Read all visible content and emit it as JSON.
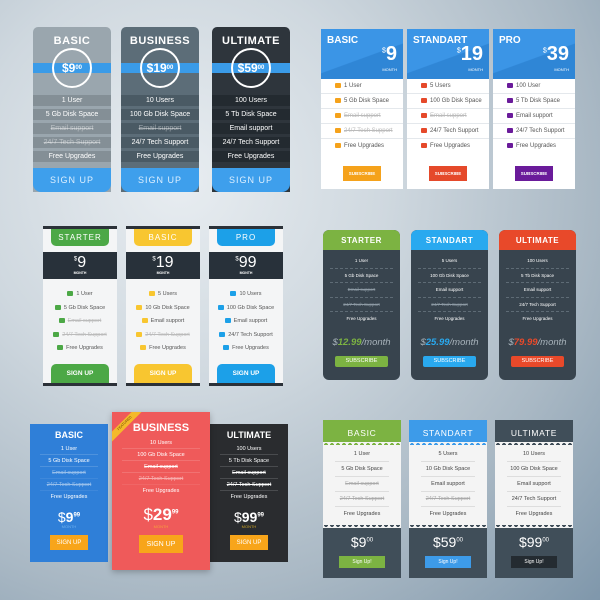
{
  "set1": {
    "colors": {
      "band": "#3a9be8",
      "button": "#3e9fec"
    },
    "plans": [
      {
        "name": "BASIC",
        "price": "$9",
        "cents": "00",
        "bg": "#9aa6ae",
        "row": "#848f96",
        "features": [
          {
            "text": "1 User",
            "active": true
          },
          {
            "text": "5 Gb Disk Space",
            "active": true
          },
          {
            "text": "Email support",
            "active": false
          },
          {
            "text": "24/7 Tech Support",
            "active": false
          },
          {
            "text": "Free Upgrades",
            "active": true
          }
        ],
        "button": "SIGN UP"
      },
      {
        "name": "BUSINESS",
        "price": "$19",
        "cents": "00",
        "bg": "#5c6d78",
        "row": "#4a5a64",
        "features": [
          {
            "text": "10 Users",
            "active": true
          },
          {
            "text": "100 Gb Disk Space",
            "active": true
          },
          {
            "text": "Email support",
            "active": false
          },
          {
            "text": "24/7 Tech Support",
            "active": true
          },
          {
            "text": "Free Upgrades",
            "active": true
          }
        ],
        "button": "SIGN UP"
      },
      {
        "name": "ULTIMATE",
        "price": "$59",
        "cents": "00",
        "bg": "#2e353c",
        "row": "#232a30",
        "features": [
          {
            "text": "100 Users",
            "active": true
          },
          {
            "text": "5 Tb Disk Space",
            "active": true
          },
          {
            "text": "Email support",
            "active": true
          },
          {
            "text": "24/7 Tech Support",
            "active": true
          },
          {
            "text": "Free Upgrades",
            "active": true
          }
        ],
        "button": "SIGN UP"
      }
    ]
  },
  "set2": {
    "plans": [
      {
        "name": "BASIC",
        "currency": "$",
        "price": "9",
        "period": "MONTH",
        "accent": "#f5a21b",
        "features": [
          {
            "text": "1 User",
            "icon": "user-icon",
            "active": true
          },
          {
            "text": "5 Gb Disk Space",
            "icon": "cloud-icon",
            "active": true
          },
          {
            "text": "Email support",
            "icon": "mail-icon",
            "active": false
          },
          {
            "text": "24/7 Tech Support",
            "icon": "headset-icon",
            "active": false
          },
          {
            "text": "Free Upgrades",
            "icon": "shield-icon",
            "active": true
          }
        ],
        "button": "SUBSCRIBE"
      },
      {
        "name": "STANDART",
        "currency": "$",
        "price": "19",
        "period": "MONTH",
        "accent": "#e5492a",
        "features": [
          {
            "text": "5 Users",
            "icon": "user-icon",
            "active": true
          },
          {
            "text": "100 Gb Disk Space",
            "icon": "cloud-icon",
            "active": true
          },
          {
            "text": "Email support",
            "icon": "mail-icon",
            "active": false
          },
          {
            "text": "24/7 Tech Support",
            "icon": "headset-icon",
            "active": true
          },
          {
            "text": "Free Upgrades",
            "icon": "shield-icon",
            "active": true
          }
        ],
        "button": "SUBSCRIBE"
      },
      {
        "name": "PRO",
        "currency": "$",
        "price": "39",
        "period": "MONTH",
        "accent": "#6a1b9a",
        "features": [
          {
            "text": "100 User",
            "icon": "user-icon",
            "active": true
          },
          {
            "text": "5 Tb Disk Space",
            "icon": "cloud-icon",
            "active": true
          },
          {
            "text": "Email support",
            "icon": "mail-icon",
            "active": true
          },
          {
            "text": "24/7 Tech Support",
            "icon": "headset-icon",
            "active": true
          },
          {
            "text": "Free Upgrades",
            "icon": "shield-icon",
            "active": true
          }
        ],
        "button": "SUBSCRIBE"
      }
    ]
  },
  "set3": {
    "plans": [
      {
        "name": "STARTER",
        "currency": "$",
        "price": "9",
        "period": "MONTH",
        "accent": "#4ca846",
        "features": [
          {
            "text": "1 User",
            "active": true
          },
          {
            "text": "5 Gb Disk Space",
            "active": true
          },
          {
            "text": "Email support",
            "active": false
          },
          {
            "text": "24/7 Tech Support",
            "active": false
          },
          {
            "text": "Free Upgrades",
            "active": true
          }
        ],
        "button": "SIGN UP"
      },
      {
        "name": "BASIC",
        "currency": "$",
        "price": "19",
        "period": "MONTH",
        "accent": "#f8c630",
        "features": [
          {
            "text": "5 Users",
            "active": true
          },
          {
            "text": "10 Gb Disk Space",
            "active": true
          },
          {
            "text": "Email support",
            "active": true
          },
          {
            "text": "24/7 Tech Support",
            "active": false
          },
          {
            "text": "Free Upgrades",
            "active": true
          }
        ],
        "button": "SIGN UP"
      },
      {
        "name": "PRO",
        "currency": "$",
        "price": "99",
        "period": "MONTH",
        "accent": "#1ca0e8",
        "features": [
          {
            "text": "10 Users",
            "active": true
          },
          {
            "text": "100 Gb Disk Space",
            "active": true
          },
          {
            "text": "Email support",
            "active": true
          },
          {
            "text": "24/7 Tech Support",
            "active": true
          },
          {
            "text": "Free Upgrades",
            "active": true
          }
        ],
        "button": "SIGN UP"
      }
    ]
  },
  "set4": {
    "plans": [
      {
        "name": "STARTER",
        "currency": "$",
        "price": "12.99",
        "per": "/month",
        "accent": "#7cb342",
        "features": [
          {
            "text": "1 User",
            "active": true
          },
          {
            "text": "5 Gb Disk Space",
            "active": true
          },
          {
            "text": "Email support",
            "active": false
          },
          {
            "text": "24/7 Tech Support",
            "active": false
          },
          {
            "text": "Free Upgrades",
            "active": true
          }
        ],
        "button": "SUBSCRIBE"
      },
      {
        "name": "STANDART",
        "currency": "$",
        "price": "25.99",
        "per": "/month",
        "accent": "#29a9ef",
        "features": [
          {
            "text": "5 Users",
            "active": true
          },
          {
            "text": "100 Gb Disk Space",
            "active": true
          },
          {
            "text": "Email support",
            "active": true
          },
          {
            "text": "24/7 Tech Support",
            "active": false
          },
          {
            "text": "Free Upgrades",
            "active": true
          }
        ],
        "button": "SUBSCRIBE"
      },
      {
        "name": "ULTIMATE",
        "currency": "$",
        "price": "79.99",
        "per": "/month",
        "accent": "#e8492a",
        "features": [
          {
            "text": "100 Users",
            "active": true
          },
          {
            "text": "5 Tb Disk Space",
            "active": true
          },
          {
            "text": "Email support",
            "active": true
          },
          {
            "text": "24/7 Tech Support",
            "active": true
          },
          {
            "text": "Free Upgrades",
            "active": true
          }
        ],
        "button": "SUBSCRIBE"
      }
    ]
  },
  "set5": {
    "ribbon": "FEATURED",
    "plans": [
      {
        "name": "BASIC",
        "currency": "$",
        "price": "9",
        "cents": "99",
        "period": "MONTH",
        "bg": "#2f7fd8",
        "period_color": "#6fb2f0",
        "features": [
          {
            "text": "1 User",
            "active": true
          },
          {
            "text": "5 Gb Disk Space",
            "active": true
          },
          {
            "text": "Email support",
            "active": false
          },
          {
            "text": "24/7 Tech Support",
            "active": false
          },
          {
            "text": "Free Upgrades",
            "active": true
          }
        ],
        "button": "SIGN UP"
      },
      {
        "name": "BUSINESS",
        "currency": "$",
        "price": "29",
        "cents": "99",
        "period": "MONTH",
        "bg": "#ef5a5a",
        "period_color": "#f7a23a",
        "featured": true,
        "features": [
          {
            "text": "10 Users",
            "active": true
          },
          {
            "text": "100 Gb Disk Space",
            "active": true
          },
          {
            "text": "Email support",
            "active": false
          },
          {
            "text": "24/7 Tech Support",
            "active": false
          },
          {
            "text": "Free Upgrades",
            "active": true
          }
        ],
        "button": "SIGN UP"
      },
      {
        "name": "ULTIMATE",
        "currency": "$",
        "price": "99",
        "cents": "99",
        "period": "MONTH",
        "bg": "#2a2c2f",
        "period_color": "#c9a227",
        "features": [
          {
            "text": "100 Users",
            "active": true
          },
          {
            "text": "5 Tb Disk Space",
            "active": true
          },
          {
            "text": "Email support",
            "active": false
          },
          {
            "text": "24/7 Tech Support",
            "active": false
          },
          {
            "text": "Free Upgrades",
            "active": true
          }
        ],
        "button": "SIGN UP"
      }
    ]
  },
  "set6": {
    "plans": [
      {
        "name": "BASIC",
        "currency": "$",
        "price": "9",
        "cents": "00",
        "accent": "#7cb342",
        "btn": "#7cb342",
        "features": [
          {
            "text": "1 User",
            "active": true
          },
          {
            "text": "5 Gb Disk Space",
            "active": true
          },
          {
            "text": "Email support",
            "active": false
          },
          {
            "text": "24/7 Tech Support",
            "active": false
          },
          {
            "text": "Free Upgrades",
            "active": true
          }
        ],
        "button": "Sign Up!"
      },
      {
        "name": "STANDART",
        "currency": "$",
        "price": "59",
        "cents": "00",
        "accent": "#3d9be9",
        "btn": "#3d9be9",
        "features": [
          {
            "text": "5 Users",
            "active": true
          },
          {
            "text": "10 Gb Disk Space",
            "active": true
          },
          {
            "text": "Email support",
            "active": true
          },
          {
            "text": "24/7 Tech Support",
            "active": false
          },
          {
            "text": "Free Upgrades",
            "active": true
          }
        ],
        "button": "Sign Up!"
      },
      {
        "name": "ULTIMATE",
        "currency": "$",
        "price": "99",
        "cents": "00",
        "accent": "#404e59",
        "btn": "#242b31",
        "features": [
          {
            "text": "10 Users",
            "active": true
          },
          {
            "text": "100 Gb Disk Space",
            "active": true
          },
          {
            "text": "Email support",
            "active": true
          },
          {
            "text": "24/7 Tech Support",
            "active": true
          },
          {
            "text": "Free Upgrades",
            "active": true
          }
        ],
        "button": "Sign Up!"
      }
    ]
  }
}
